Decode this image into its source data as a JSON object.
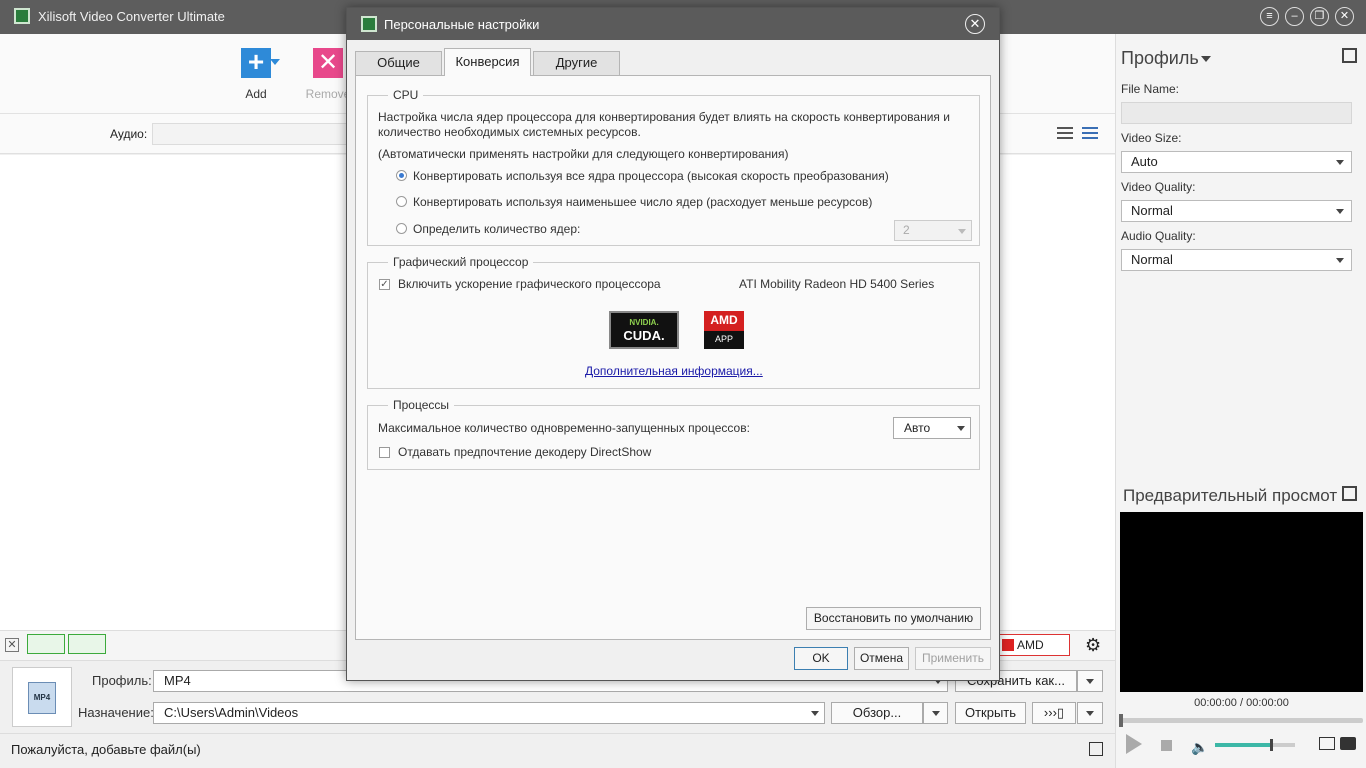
{
  "app": {
    "title": "Xilisoft Video Converter Ultimate",
    "window_buttons": [
      "≡",
      "–",
      "❐",
      "✕"
    ]
  },
  "toolbar": {
    "add_label": "Add",
    "remove_label": "Remove"
  },
  "audio": {
    "label": "Аудио:"
  },
  "statusstrip": {
    "amd_app_label": "AMD APP"
  },
  "output": {
    "profile_label": "Профиль:",
    "profile_value": "MP4",
    "save_as_label": "Сохранить как...",
    "destination_label": "Назначение:",
    "destination_value": "C:\\Users\\Admin\\Videos",
    "browse_label": "Обзор...",
    "open_label": "Открыть",
    "mp4_icon_text": "MP4"
  },
  "statusbar": {
    "text": "Пожалуйста, добавьте файл(ы)"
  },
  "rightpanel": {
    "heading": "Профиль",
    "file_name_label": "File Name:",
    "video_size_label": "Video Size:",
    "video_size_value": "Auto",
    "video_quality_label": "Video Quality:",
    "video_quality_value": "Normal",
    "audio_quality_label": "Audio Quality:",
    "audio_quality_value": "Normal",
    "preview_heading": "Предварительный просмотр",
    "time": "00:00:00 / 00:00:00",
    "volume_level": 0.7
  },
  "dialog": {
    "title": "Персональные настройки",
    "tabs": [
      "Общие",
      "Конверсия",
      "Другие"
    ],
    "active_tab": "Конверсия",
    "cpu": {
      "legend": "CPU",
      "desc_line1": "Настройка числа ядер процессора для конвертирования будет влиять на скорость конвертирования и",
      "desc_line2": "количество необходимых системных ресурсов.",
      "note": "(Автоматически применять настройки для следующего конвертирования)",
      "option_all": "Конвертировать используя все ядра процессора (высокая скорость преобразования)",
      "option_min": "Конвертировать используя наименьшее число ядер (расходует меньше ресурсов)",
      "option_custom": "Определить количество ядер:",
      "cores_value": "2"
    },
    "gpu": {
      "legend": "Графический процессор",
      "enable_label": "Включить ускорение графического процессора",
      "gpu_name": "ATI Mobility Radeon HD 5400 Series",
      "nvidia_l1": "NVIDIA.",
      "nvidia_l2": "CUDA.",
      "amd_l1": "AMD",
      "amd_l2": "APP",
      "more_info": "Дополнительная информация..."
    },
    "processes": {
      "legend": "Процессы",
      "max_label": "Максимальное количество одновременно-запущенных процессов:",
      "max_value": "Авто",
      "directshow_label": "Отдавать предпочтение декодеру DirectShow"
    },
    "restore_label": "Восстановить по умолчанию",
    "ok_label": "OK",
    "cancel_label": "Отмена",
    "apply_label": "Применить"
  }
}
